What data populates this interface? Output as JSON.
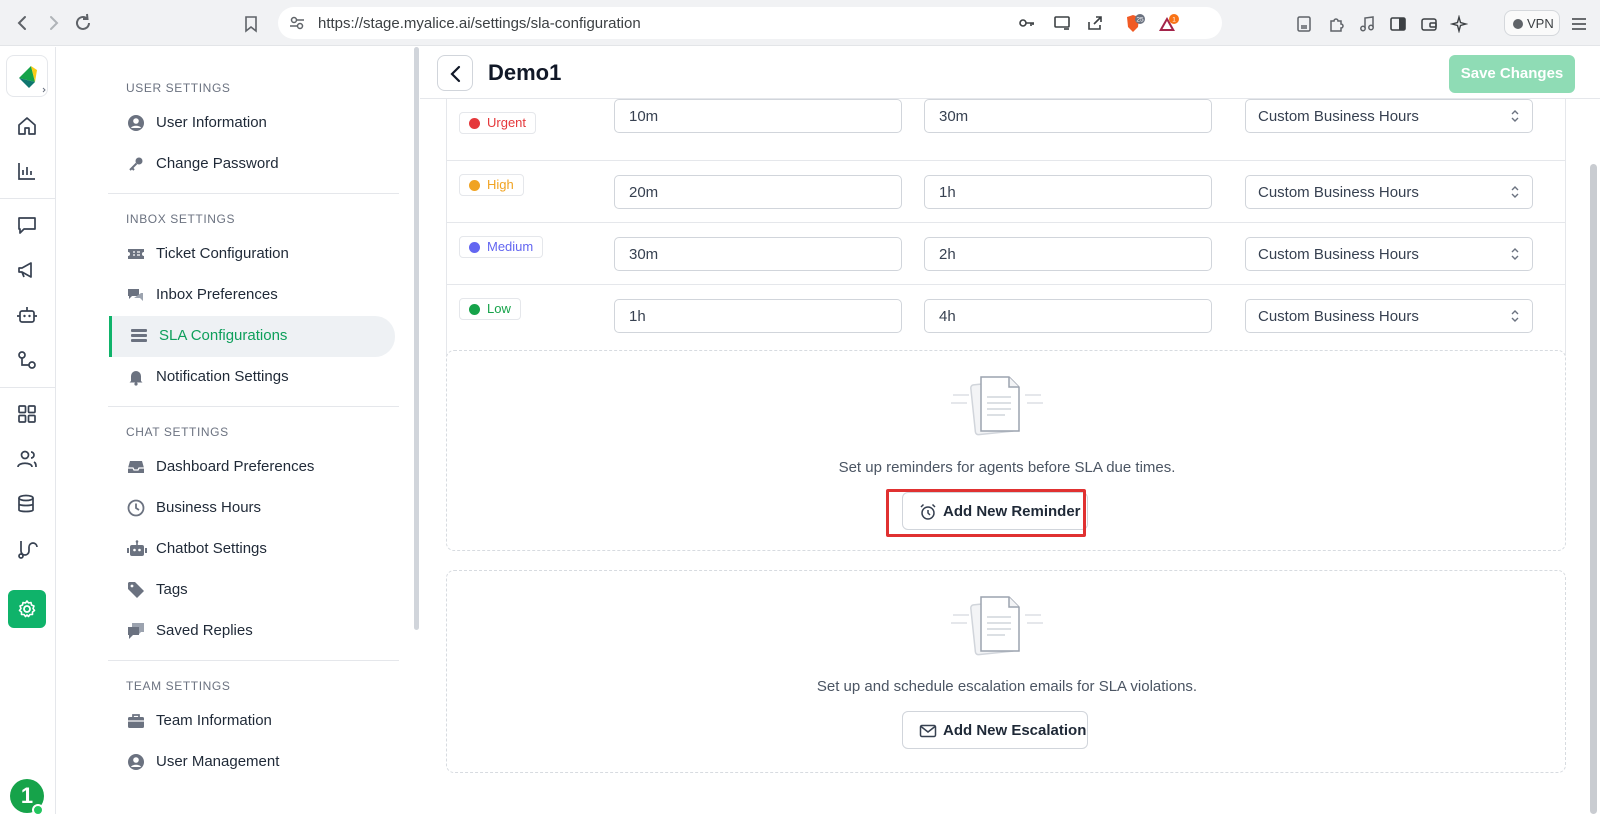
{
  "browser": {
    "url": "https://stage.myalice.ai/settings/sla-configuration",
    "vpn_label": "VPN",
    "shield_count": "25",
    "alert_count": "1"
  },
  "rail": {
    "avatar_label": "1",
    "accent_color": "#0fb36a"
  },
  "settings_nav": {
    "sections": [
      {
        "title": "USER SETTINGS",
        "items": [
          {
            "label": "User Information",
            "icon": "user-circle-icon"
          },
          {
            "label": "Change Password",
            "icon": "key-icon"
          }
        ]
      },
      {
        "title": "INBOX SETTINGS",
        "items": [
          {
            "label": "Ticket Configuration",
            "icon": "ticket-icon"
          },
          {
            "label": "Inbox Preferences",
            "icon": "chat-bubbles-icon"
          },
          {
            "label": "SLA Configurations",
            "icon": "list-icon",
            "active": true
          },
          {
            "label": "Notification Settings",
            "icon": "bell-icon"
          }
        ]
      },
      {
        "title": "CHAT SETTINGS",
        "items": [
          {
            "label": "Dashboard Preferences",
            "icon": "inbox-tray-icon"
          },
          {
            "label": "Business Hours",
            "icon": "clock-icon"
          },
          {
            "label": "Chatbot Settings",
            "icon": "robot-icon"
          },
          {
            "label": "Tags",
            "icon": "tag-icon"
          },
          {
            "label": "Saved Replies",
            "icon": "saved-reply-icon"
          }
        ]
      },
      {
        "title": "TEAM SETTINGS",
        "items": [
          {
            "label": "Team Information",
            "icon": "briefcase-icon"
          },
          {
            "label": "User Management",
            "icon": "user-circle-icon"
          }
        ]
      }
    ]
  },
  "main": {
    "title": "Demo1",
    "save_label": "Save Changes",
    "priorities": [
      {
        "label": "Urgent",
        "color": "#e5383b",
        "first_response": "10m",
        "resolution": "30m",
        "hours": "Custom Business Hours"
      },
      {
        "label": "High",
        "color": "#f0a322",
        "first_response": "20m",
        "resolution": "1h",
        "hours": "Custom Business Hours"
      },
      {
        "label": "Medium",
        "color": "#6366f1",
        "first_response": "30m",
        "resolution": "2h",
        "hours": "Custom Business Hours"
      },
      {
        "label": "Low",
        "color": "#16a34a",
        "first_response": "1h",
        "resolution": "4h",
        "hours": "Custom Business Hours"
      }
    ],
    "reminder": {
      "text": "Set up reminders for agents before SLA due times.",
      "button": "Add New Reminder"
    },
    "escalation": {
      "text": "Set up and schedule escalation emails for SLA violations.",
      "button": "Add New Escalation"
    }
  }
}
